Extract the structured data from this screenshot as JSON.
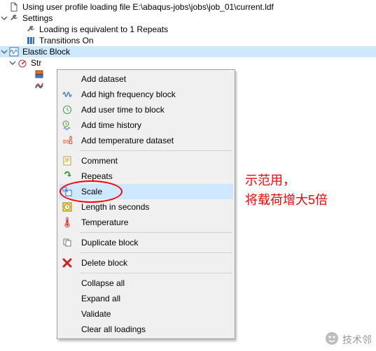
{
  "tree": {
    "profile_line": "Using user profile loading file E:\\abaqus-jobs\\jobs\\job_01\\current.ldf",
    "settings_label": "Settings",
    "loading_repeats": "Loading is equivalent to 1 Repeats",
    "transitions_on": "Transitions On",
    "elastic_block": "Elastic Block",
    "strain_prefix": "Str"
  },
  "menu": {
    "add_dataset": "Add dataset",
    "add_high_freq": "Add high frequency block",
    "add_user_time": "Add user time to block",
    "add_time_history": "Add time history",
    "add_temp_dataset": "Add temperature dataset",
    "comment": "Comment",
    "repeats": "Repeats",
    "scale": "Scale",
    "length_seconds": "Length in seconds",
    "temperature": "Temperature",
    "duplicate_block": "Duplicate block",
    "delete_block": "Delete block",
    "collapse_all": "Collapse all",
    "expand_all": "Expand all",
    "validate": "Validate",
    "clear_all": "Clear all loadings"
  },
  "annotation": {
    "line1": "示范用，",
    "line2": "将载荷增大5倍"
  },
  "watermark": "技术邻"
}
